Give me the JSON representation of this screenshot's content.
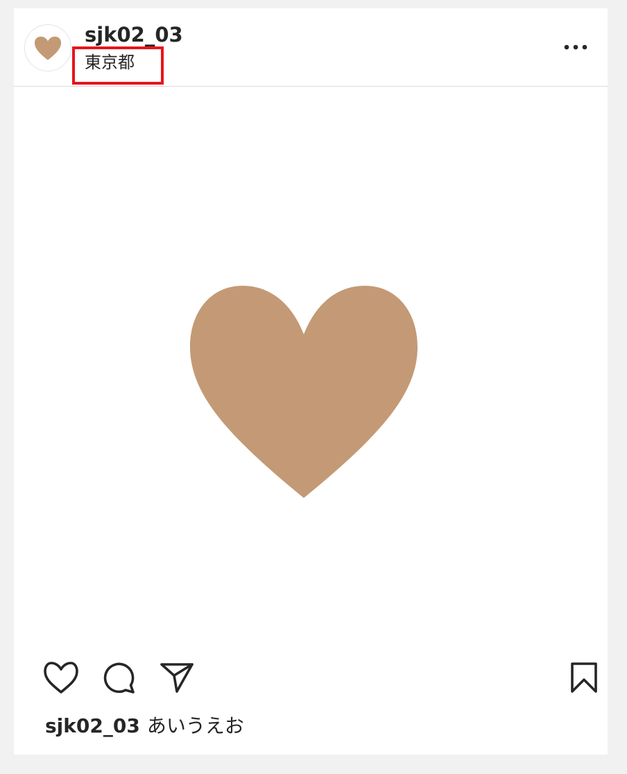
{
  "post": {
    "username": "sjk02_03",
    "location": "東京都",
    "caption_username": "sjk02_03",
    "caption_text": "あいうえお"
  },
  "icons": {
    "avatar": "heart-icon",
    "more": "more-options-icon",
    "like": "heart-outline-icon",
    "comment": "comment-icon",
    "share": "paper-plane-icon",
    "save": "bookmark-icon",
    "photo": "heart-image"
  },
  "colors": {
    "heart": "#c39a75",
    "highlight": "#e8141a",
    "text": "#262626"
  }
}
